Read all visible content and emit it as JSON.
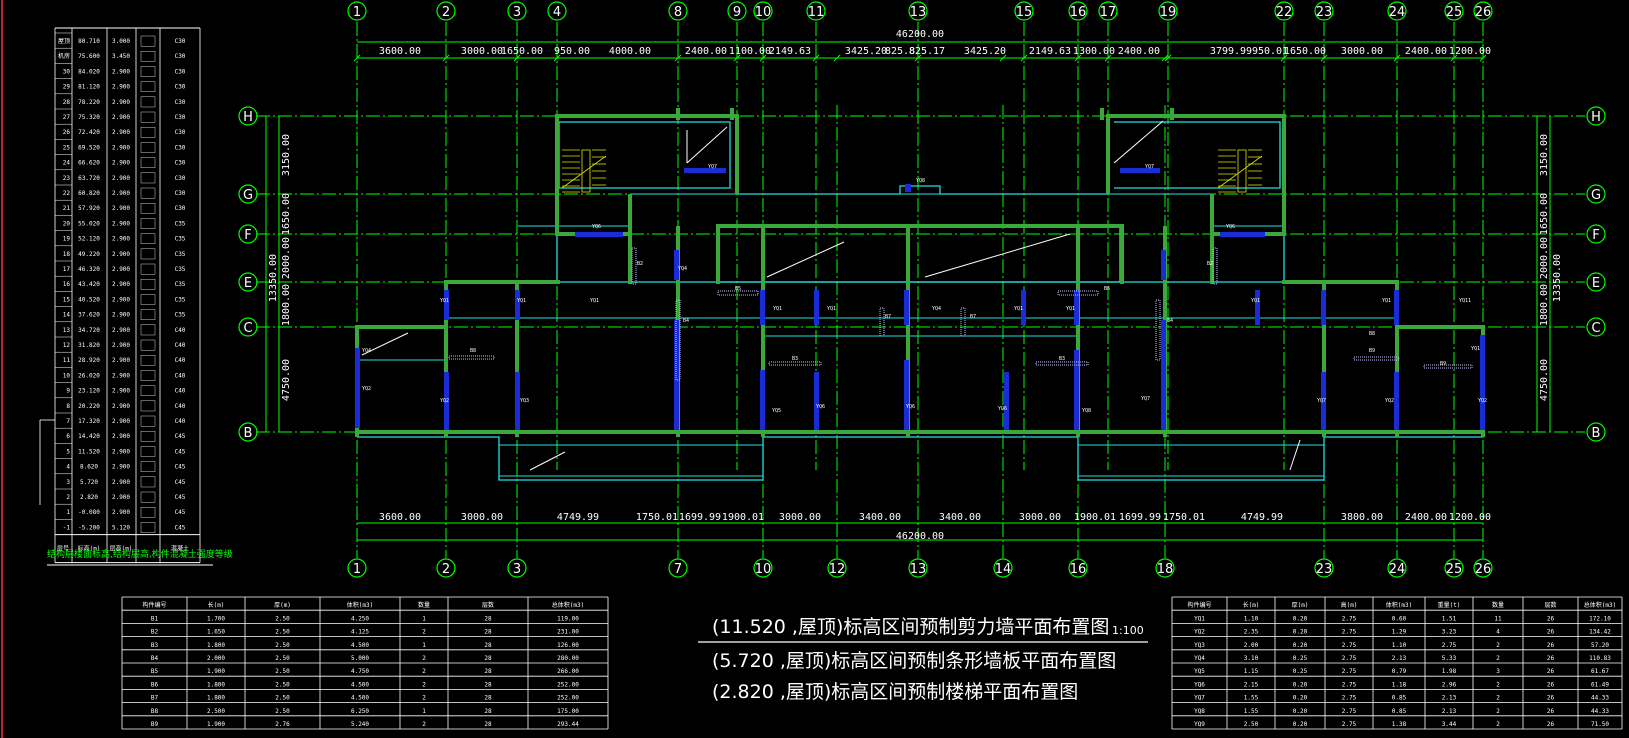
{
  "top_total": "46200.00",
  "bottom_total": "46200.00",
  "top_axes": [
    "1",
    "2",
    "3",
    "4",
    "8",
    "9",
    "10",
    "11",
    "13",
    "15",
    "16",
    "17",
    "19",
    "22",
    "23",
    "24",
    "25",
    "26"
  ],
  "top_dims": [
    "3600.00",
    "3000.00",
    "1650.00",
    "950.00",
    "4000.00",
    "2400.00",
    "1100.00",
    "2149.63",
    "3425.20",
    "825.8",
    "825.17",
    "3425.20",
    "2149.63",
    "1300.00",
    "2400.00",
    "3799.99",
    "950.01",
    "1650.00",
    "3000.00",
    "2400.00",
    "1200.00"
  ],
  "bottom_axes": [
    "1",
    "2",
    "3",
    "7",
    "10",
    "12",
    "13",
    "14",
    "16",
    "18",
    "23",
    "24",
    "25",
    "26"
  ],
  "bottom_dims": [
    "3600.00",
    "3000.00",
    "4749.99",
    "1750.01",
    "1699.99",
    "1900.01",
    "3000.00",
    "3400.00",
    "3400.00",
    "3000.00",
    "1900.01",
    "1699.99",
    "1750.01",
    "4749.99",
    "3800.00",
    "2400.00",
    "1200.00"
  ],
  "row_axes": [
    "H",
    "G",
    "F",
    "E",
    "C",
    "B"
  ],
  "side_dims": [
    "3150.00",
    "1650.00",
    "2000.00",
    "1800.00",
    "4750.00"
  ],
  "side_total": "13350.00",
  "titles": {
    "main": "(11.520 ,屋顶)标高区间预制剪力墙平面布置图",
    "sub1": "(5.720 ,屋顶)标高区间预制条形墙板平面布置图",
    "sub2": "(2.820 ,屋顶)标高区间预制楼梯平面布置图",
    "scale": "1:100"
  },
  "floor_table": {
    "footer": "结构层楼面标高,结构层高,构件混凝土强度等级",
    "rows": [
      [
        "屋顶",
        "80.710",
        "3.000",
        "C30"
      ],
      [
        "机房",
        "75.600",
        "3.450",
        "C30"
      ],
      [
        "30",
        "84.020",
        "2.900",
        "C30"
      ],
      [
        "29",
        "81.120",
        "2.900",
        "C30"
      ],
      [
        "28",
        "78.220",
        "2.900",
        "C30"
      ],
      [
        "27",
        "75.320",
        "2.900",
        "C30"
      ],
      [
        "26",
        "72.420",
        "2.900",
        "C30"
      ],
      [
        "25",
        "69.520",
        "2.900",
        "C30"
      ],
      [
        "24",
        "66.620",
        "2.900",
        "C30"
      ],
      [
        "23",
        "63.720",
        "2.900",
        "C30"
      ],
      [
        "22",
        "60.820",
        "2.900",
        "C30"
      ],
      [
        "21",
        "57.920",
        "2.900",
        "C30"
      ],
      [
        "20",
        "55.020",
        "2.900",
        "C35"
      ],
      [
        "19",
        "52.120",
        "2.900",
        "C35"
      ],
      [
        "18",
        "49.220",
        "2.900",
        "C35"
      ],
      [
        "17",
        "46.320",
        "2.900",
        "C35"
      ],
      [
        "16",
        "43.420",
        "2.900",
        "C35"
      ],
      [
        "15",
        "40.520",
        "2.900",
        "C35"
      ],
      [
        "14",
        "37.620",
        "2.900",
        "C35"
      ],
      [
        "13",
        "34.720",
        "2.900",
        "C40"
      ],
      [
        "12",
        "31.820",
        "2.900",
        "C40"
      ],
      [
        "11",
        "28.920",
        "2.900",
        "C40"
      ],
      [
        "10",
        "26.020",
        "2.900",
        "C40"
      ],
      [
        "9",
        "23.120",
        "2.900",
        "C40"
      ],
      [
        "8",
        "20.220",
        "2.900",
        "C40"
      ],
      [
        "7",
        "17.320",
        "2.900",
        "C40"
      ],
      [
        "6",
        "14.420",
        "2.900",
        "C45"
      ],
      [
        "5",
        "11.520",
        "2.900",
        "C45"
      ],
      [
        "4",
        "8.620",
        "2.900",
        "C45"
      ],
      [
        "3",
        "5.720",
        "2.900",
        "C45"
      ],
      [
        "2",
        "2.820",
        "2.900",
        "C45"
      ],
      [
        "1",
        "-0.080",
        "2.900",
        "C45"
      ],
      [
        "-1",
        "-5.200",
        "5.120",
        "C45"
      ]
    ],
    "head": [
      "层号",
      "标高(m)",
      "层高(m)",
      "混凝土"
    ]
  },
  "left_table": {
    "head": [
      "构件编号",
      "长(m)",
      "厚(m)",
      "体积(m3)",
      "数量",
      "层数",
      "总体积(m3)"
    ],
    "rows": [
      [
        "B1",
        "1.700",
        "2.50",
        "4.250",
        "1",
        "28",
        "119.00"
      ],
      [
        "B2",
        "1.650",
        "2.50",
        "4.125",
        "2",
        "28",
        "231.00"
      ],
      [
        "B3",
        "1.800",
        "2.50",
        "4.500",
        "1",
        "28",
        "126.00"
      ],
      [
        "B4",
        "2.000",
        "2.50",
        "5.000",
        "2",
        "28",
        "280.00"
      ],
      [
        "B5",
        "1.900",
        "2.50",
        "4.750",
        "2",
        "28",
        "266.00"
      ],
      [
        "B6",
        "1.800",
        "2.50",
        "4.500",
        "2",
        "28",
        "252.00"
      ],
      [
        "B7",
        "1.800",
        "2.50",
        "4.500",
        "2",
        "28",
        "252.00"
      ],
      [
        "B8",
        "2.500",
        "2.50",
        "6.250",
        "1",
        "28",
        "175.00"
      ],
      [
        "B9",
        "1.900",
        "2.76",
        "5.240",
        "2",
        "28",
        "293.44"
      ]
    ]
  },
  "right_table": {
    "head": [
      "构件编号",
      "长(m)",
      "厚(m)",
      "高(m)",
      "体积(m3)",
      "重量(t)",
      "数量",
      "层数",
      "总体积(m3)"
    ],
    "rows": [
      [
        "YQ1",
        "1.10",
        "0.20",
        "2.75",
        "0.60",
        "1.51",
        "11",
        "26",
        "172.10"
      ],
      [
        "YQ2",
        "2.35",
        "0.20",
        "2.75",
        "1.29",
        "3.23",
        "4",
        "26",
        "134.42"
      ],
      [
        "YQ3",
        "2.00",
        "0.20",
        "2.75",
        "1.10",
        "2.75",
        "2",
        "26",
        "57.20"
      ],
      [
        "YQ4",
        "3.10",
        "0.25",
        "2.75",
        "2.13",
        "5.33",
        "2",
        "26",
        "110.83"
      ],
      [
        "YQ5",
        "1.15",
        "0.25",
        "2.75",
        "0.79",
        "1.98",
        "3",
        "26",
        "61.67"
      ],
      [
        "YQ6",
        "2.15",
        "0.20",
        "2.75",
        "1.18",
        "2.96",
        "2",
        "26",
        "61.49"
      ],
      [
        "YQ7",
        "1.55",
        "0.20",
        "2.75",
        "0.85",
        "2.13",
        "2",
        "26",
        "44.33"
      ],
      [
        "YQ8",
        "1.55",
        "0.20",
        "2.75",
        "0.85",
        "2.13",
        "2",
        "26",
        "44.33"
      ],
      [
        "YQ9",
        "2.50",
        "0.20",
        "2.75",
        "1.38",
        "3.44",
        "2",
        "26",
        "71.50"
      ]
    ]
  }
}
